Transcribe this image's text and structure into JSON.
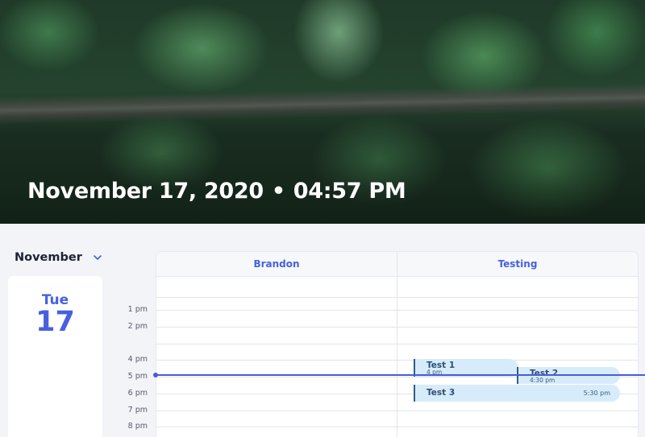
{
  "header": {
    "date": "November 17, 2020",
    "separator": "•",
    "time": "04:57 PM"
  },
  "month_selector": {
    "label": "November",
    "icon": "chevron-down-icon"
  },
  "day_card": {
    "weekday": "Tue",
    "day_number": "17"
  },
  "columns": [
    "Brandon",
    "Testing"
  ],
  "time_labels": [
    "1 pm",
    "2 pm",
    "4 pm",
    "5 pm",
    "6 pm",
    "7 pm",
    "8 pm"
  ],
  "events": [
    {
      "title": "Test 1",
      "time": "4 pm"
    },
    {
      "title": "Test 2",
      "time": "4:30 pm"
    },
    {
      "title": "Test 3",
      "time": "5:30 pm"
    }
  ],
  "colors": {
    "accent": "#4760e0",
    "now_line": "#4a5ad8",
    "event_bg": "#d7ecfb",
    "event_bar": "#2f5d89"
  }
}
